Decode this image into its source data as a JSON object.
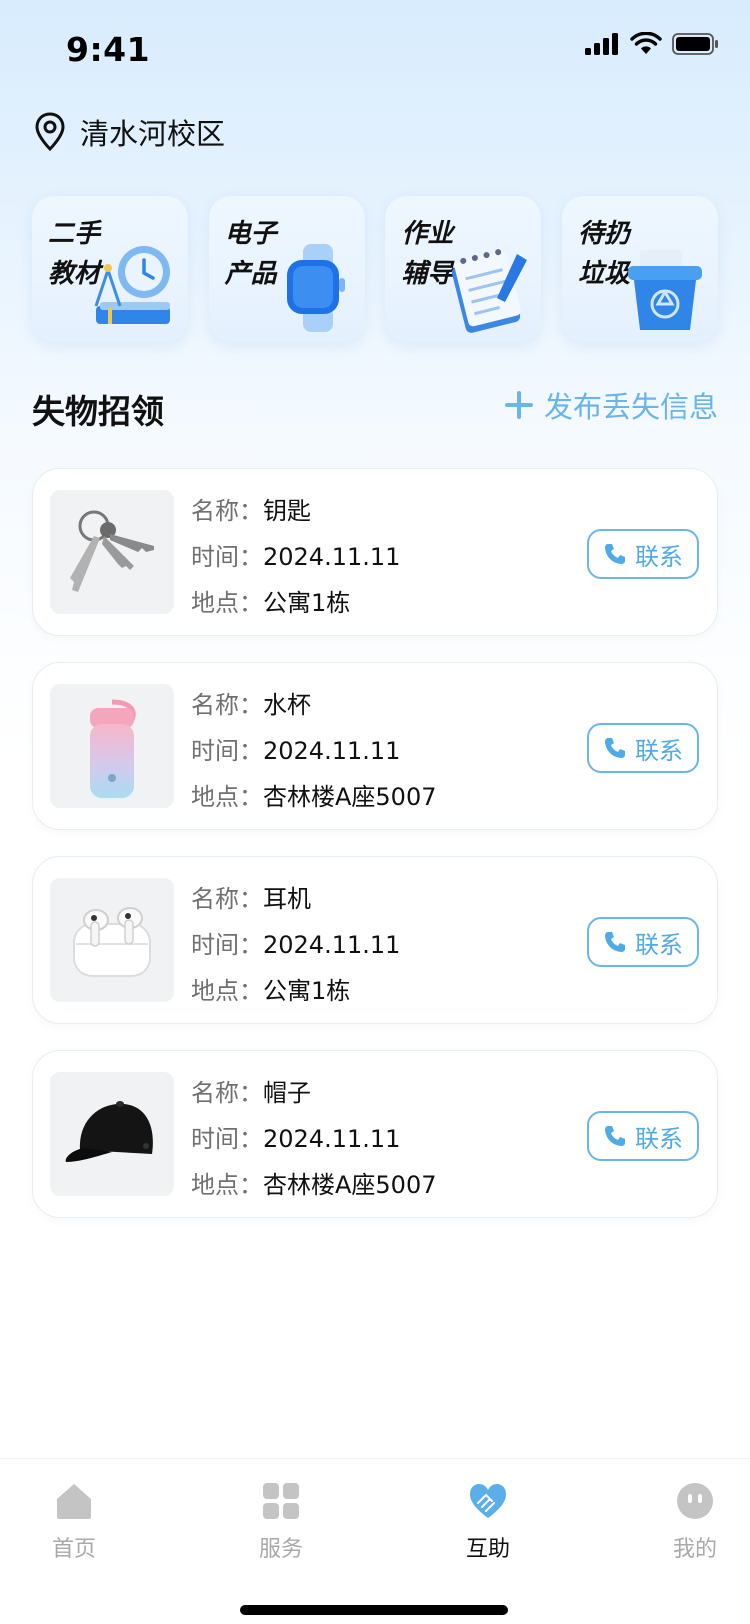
{
  "status_bar": {
    "time": "9:41"
  },
  "location": {
    "label": "清水河校区",
    "icon": "location-pin-icon"
  },
  "categories": [
    {
      "label": "二手\n教材",
      "icon": "textbook-icon"
    },
    {
      "label": "电子\n产品",
      "icon": "smartwatch-icon"
    },
    {
      "label": "作业\n辅导",
      "icon": "notebook-pen-icon"
    },
    {
      "label": "待扔\n垃圾",
      "icon": "recycle-bin-icon"
    }
  ],
  "section": {
    "title": "失物招领",
    "post_label": "发布丢失信息"
  },
  "field_labels": {
    "name": "名称：",
    "time": "时间：",
    "place": "地点："
  },
  "items": [
    {
      "name": "钥匙",
      "time": "2024.11.11",
      "place": "公寓1栋",
      "image": "keys-image",
      "contact": "联系"
    },
    {
      "name": "水杯",
      "time": "2024.11.11",
      "place": "杏林楼A座5007",
      "image": "cup-image",
      "contact": "联系"
    },
    {
      "name": "耳机",
      "time": "2024.11.11",
      "place": "公寓1栋",
      "image": "earbuds-image",
      "contact": "联系"
    },
    {
      "name": "帽子",
      "time": "2024.11.11",
      "place": "杏林楼A座5007",
      "image": "cap-image",
      "contact": "联系"
    }
  ],
  "tabs": [
    {
      "label": "首页",
      "icon": "home-icon",
      "active": false
    },
    {
      "label": "服务",
      "icon": "grid-icon",
      "active": false
    },
    {
      "label": "互助",
      "icon": "heart-hands-icon",
      "active": true
    },
    {
      "label": "我的",
      "icon": "profile-face-icon",
      "active": false
    }
  ],
  "colors": {
    "accent": "#5aaeea",
    "tab_inactive": "#c4c4c4",
    "text_primary": "#111111"
  }
}
